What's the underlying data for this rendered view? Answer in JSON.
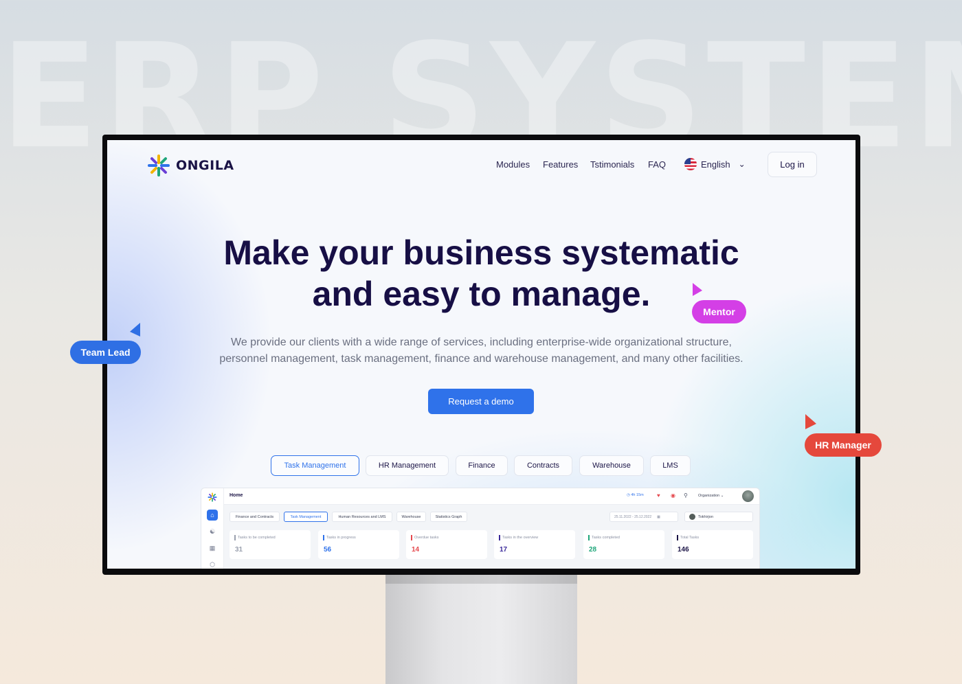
{
  "background": {
    "title": "ERP SYSTEM"
  },
  "brand": {
    "name": "ONGILA"
  },
  "nav": {
    "links": [
      "Modules",
      "Features",
      "Tstimonials",
      "FAQ"
    ],
    "language": "English",
    "login_label": "Log in"
  },
  "hero": {
    "title_line1": "Make your business systematic",
    "title_line2": "and easy to manage.",
    "subtitle_line1": "We provide our clients with a wide range of services, including enterprise-wide organizational structure,",
    "subtitle_line2": "personnel management, task management, finance and warehouse management, and many other facilities.",
    "cta_label": "Request a demo"
  },
  "module_tabs": [
    "Task Management",
    "HR Management",
    "Finance",
    "Contracts",
    "Warehouse",
    "LMS"
  ],
  "active_module_tab": "Task Management",
  "dashboard": {
    "page_title": "Home",
    "timer": "4h 15m",
    "organization": "Organization",
    "tabs": [
      "Finance and Contracts",
      "Task Management",
      "Human Resources and LMS",
      "Warehouse",
      "Statistics Graph"
    ],
    "active_tab": "Task Management",
    "date_range": "25.11.2022 - 25.12.2022",
    "user_name": "Tokhirjon",
    "stats": [
      {
        "label": "Tasks to be completed",
        "value": "31",
        "color": "#9aa0ae"
      },
      {
        "label": "Tasks in progress",
        "value": "56",
        "color": "#2f72ea"
      },
      {
        "label": "Overdue tasks",
        "value": "14",
        "color": "#e5484d"
      },
      {
        "label": "Tasks in the overview",
        "value": "17",
        "color": "#3b2a9a"
      },
      {
        "label": "Tasks completed",
        "value": "28",
        "color": "#1fa67a"
      },
      {
        "label": "Total Tasks",
        "value": "146",
        "color": "#1b1446"
      }
    ]
  },
  "floating_labels": {
    "team_lead": {
      "text": "Team Lead",
      "color": "#2f6fe4"
    },
    "mentor": {
      "text": "Mentor",
      "color": "#d43fe6"
    },
    "hr_manager": {
      "text": "HR Manager",
      "color": "#e5483c"
    }
  },
  "colors": {
    "primary": "#2f72ea",
    "heading": "#170f45",
    "text_muted": "#6a6f80"
  },
  "icons": [
    "logo-asterisk-icon",
    "us-flag-icon",
    "chevron-down-icon",
    "clock-icon",
    "bell-icon",
    "search-icon",
    "home-icon",
    "users-icon",
    "calendar-icon",
    "box-icon",
    "cursor-icon"
  ]
}
